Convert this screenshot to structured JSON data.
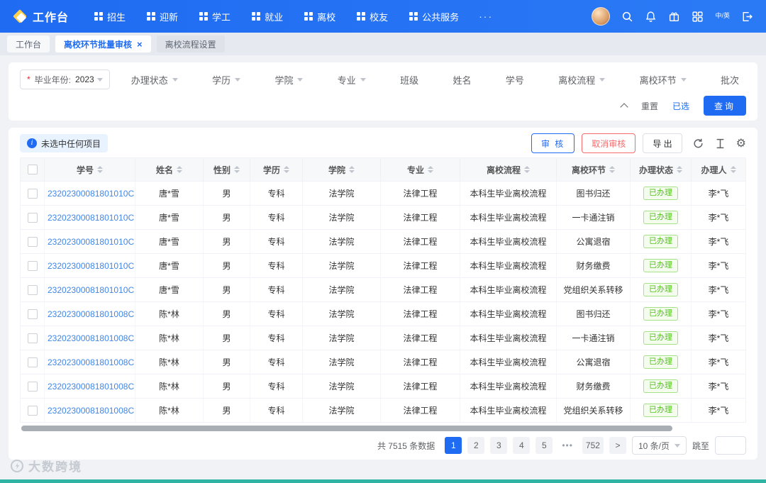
{
  "colors": {
    "primary": "#1f6bf2",
    "success": "#52c41a",
    "danger": "#f56c6c"
  },
  "icons": {
    "close": "×",
    "gear": "⚙",
    "next": ">"
  },
  "navbar": {
    "logo": "工作台",
    "items": [
      "招生",
      "迎新",
      "学工",
      "就业",
      "离校",
      "校友",
      "公共服务"
    ],
    "more": "···",
    "lang": "中/英"
  },
  "tabs": [
    {
      "label": "工作台",
      "active": false,
      "closable": false
    },
    {
      "label": "离校环节批量审核",
      "active": true,
      "closable": true
    },
    {
      "label": "离校流程设置",
      "active": false,
      "closable": false
    }
  ],
  "filter": {
    "year": {
      "required": "*",
      "label": "毕业年份:",
      "value": "2023"
    },
    "fields": [
      {
        "label": "办理状态",
        "dropdown": true
      },
      {
        "label": "学历",
        "dropdown": true
      },
      {
        "label": "学院",
        "dropdown": true
      },
      {
        "label": "专业",
        "dropdown": true
      },
      {
        "label": "班级",
        "dropdown": false
      },
      {
        "label": "姓名",
        "dropdown": false
      },
      {
        "label": "学号",
        "dropdown": false
      },
      {
        "label": "离校流程",
        "dropdown": true
      },
      {
        "label": "离校环节",
        "dropdown": true
      },
      {
        "label": "批次",
        "dropdown": false
      }
    ],
    "reset": "重置",
    "selected": "已选",
    "query": "查询"
  },
  "toolbar": {
    "notice": "未选中任何项目",
    "audit": "审 核",
    "cancel_audit": "取消审核",
    "export": "导 出"
  },
  "table": {
    "columns": [
      {
        "key": "id",
        "label": "学号"
      },
      {
        "key": "name",
        "label": "姓名"
      },
      {
        "key": "gender",
        "label": "性别"
      },
      {
        "key": "degree",
        "label": "学历"
      },
      {
        "key": "college",
        "label": "学院"
      },
      {
        "key": "major",
        "label": "专业"
      },
      {
        "key": "process",
        "label": "离校流程"
      },
      {
        "key": "step",
        "label": "离校环节"
      },
      {
        "key": "status",
        "label": "办理状态"
      },
      {
        "key": "handler",
        "label": "办理人"
      }
    ],
    "rows": [
      {
        "id": "23202300081801010C",
        "name": "唐*雪",
        "gender": "男",
        "degree": "专科",
        "college": "法学院",
        "major": "法律工程",
        "process": "本科生毕业离校流程",
        "step": "图书归还",
        "status": "已办理",
        "handler": "李*飞"
      },
      {
        "id": "23202300081801010C",
        "name": "唐*雪",
        "gender": "男",
        "degree": "专科",
        "college": "法学院",
        "major": "法律工程",
        "process": "本科生毕业离校流程",
        "step": "一卡通注销",
        "status": "已办理",
        "handler": "李*飞"
      },
      {
        "id": "23202300081801010C",
        "name": "唐*雪",
        "gender": "男",
        "degree": "专科",
        "college": "法学院",
        "major": "法律工程",
        "process": "本科生毕业离校流程",
        "step": "公寓退宿",
        "status": "已办理",
        "handler": "李*飞"
      },
      {
        "id": "23202300081801010C",
        "name": "唐*雪",
        "gender": "男",
        "degree": "专科",
        "college": "法学院",
        "major": "法律工程",
        "process": "本科生毕业离校流程",
        "step": "财务缴费",
        "status": "已办理",
        "handler": "李*飞"
      },
      {
        "id": "23202300081801010C",
        "name": "唐*雪",
        "gender": "男",
        "degree": "专科",
        "college": "法学院",
        "major": "法律工程",
        "process": "本科生毕业离校流程",
        "step": "党组织关系转移",
        "status": "已办理",
        "handler": "李*飞"
      },
      {
        "id": "23202300081801008C",
        "name": "陈*林",
        "gender": "男",
        "degree": "专科",
        "college": "法学院",
        "major": "法律工程",
        "process": "本科生毕业离校流程",
        "step": "图书归还",
        "status": "已办理",
        "handler": "李*飞"
      },
      {
        "id": "23202300081801008C",
        "name": "陈*林",
        "gender": "男",
        "degree": "专科",
        "college": "法学院",
        "major": "法律工程",
        "process": "本科生毕业离校流程",
        "step": "一卡通注销",
        "status": "已办理",
        "handler": "李*飞"
      },
      {
        "id": "23202300081801008C",
        "name": "陈*林",
        "gender": "男",
        "degree": "专科",
        "college": "法学院",
        "major": "法律工程",
        "process": "本科生毕业离校流程",
        "step": "公寓退宿",
        "status": "已办理",
        "handler": "李*飞"
      },
      {
        "id": "23202300081801008C",
        "name": "陈*林",
        "gender": "男",
        "degree": "专科",
        "college": "法学院",
        "major": "法律工程",
        "process": "本科生毕业离校流程",
        "step": "财务缴费",
        "status": "已办理",
        "handler": "李*飞"
      },
      {
        "id": "23202300081801008C",
        "name": "陈*林",
        "gender": "男",
        "degree": "专科",
        "college": "法学院",
        "major": "法律工程",
        "process": "本科生毕业离校流程",
        "step": "党组织关系转移",
        "status": "已办理",
        "handler": "李*飞"
      }
    ]
  },
  "pagination": {
    "total": "共 7515 条数据",
    "pages": [
      "1",
      "2",
      "3",
      "4",
      "5",
      "•••",
      "752"
    ],
    "active_page": "1",
    "page_size": "10 条/页",
    "jump_label": "跳至"
  },
  "watermark": "大数跨境"
}
